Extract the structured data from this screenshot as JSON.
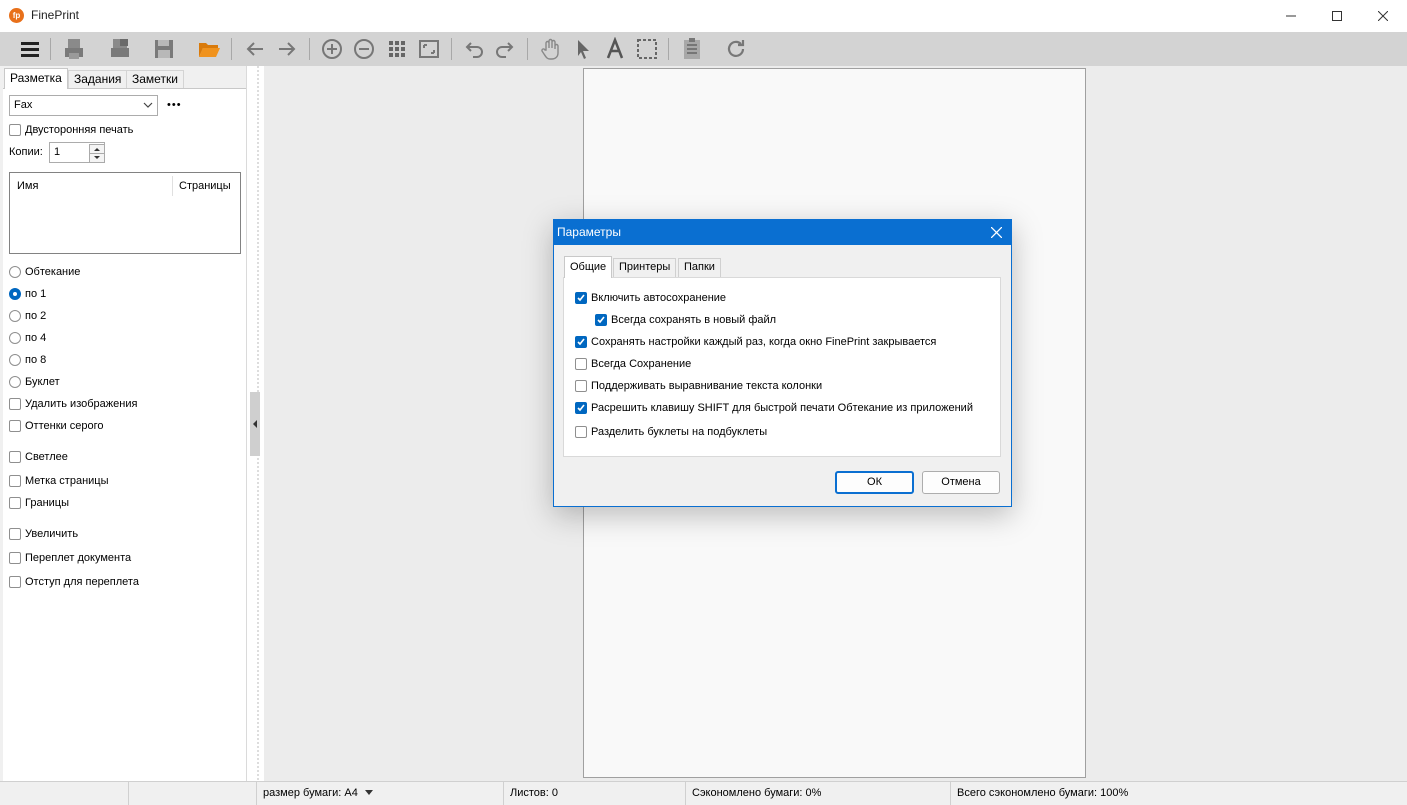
{
  "window": {
    "title": "FinePrint",
    "app_icon_text": "fp"
  },
  "toolbar": {
    "icons": [
      "menu-icon",
      "print-icon",
      "print-preview-icon",
      "save-icon",
      "open-folder-icon",
      "back-arrow-icon",
      "forward-arrow-icon",
      "zoom-in-icon",
      "zoom-out-icon",
      "grid-view-icon",
      "fit-page-icon",
      "undo-icon",
      "redo-icon",
      "hand-icon",
      "pointer-icon",
      "text-icon",
      "select-region-icon",
      "page-setup-icon",
      "refresh-icon"
    ]
  },
  "left_panel": {
    "tabs": [
      "Разметка",
      "Задания",
      "Заметки"
    ],
    "printer_combo": "Fax",
    "more_button": "•••",
    "duplex_label": "Двусторонняя печать",
    "copies_label": "Копии:",
    "copies_value": "1",
    "list_headers": {
      "name": "Имя",
      "pages": "Страницы"
    },
    "radios": [
      {
        "label": "Обтекание",
        "checked": false
      },
      {
        "label": "по 1",
        "checked": true
      },
      {
        "label": "по 2",
        "checked": false
      },
      {
        "label": "по 4",
        "checked": false
      },
      {
        "label": "по 8",
        "checked": false
      },
      {
        "label": "Буклет",
        "checked": false
      }
    ],
    "checks": [
      {
        "label": "Удалить изображения",
        "checked": false
      },
      {
        "label": "Оттенки серого",
        "checked": false
      },
      {
        "label": "Светлее",
        "checked": false
      },
      {
        "label": "Метка страницы",
        "checked": false
      },
      {
        "label": "Границы",
        "checked": false
      },
      {
        "label": "Увеличить",
        "checked": false
      },
      {
        "label": "Переплет документа",
        "checked": false
      },
      {
        "label": "Отступ для переплета",
        "checked": false
      }
    ]
  },
  "status_bar": {
    "paper_size": "размер бумаги: A4",
    "sheets": "Листов: 0",
    "paper_saved": "Сэкономлено бумаги: 0%",
    "total_saved": "Всего сэкономлено бумаги: 100%"
  },
  "dialog": {
    "title": "Параметры",
    "tabs": [
      "Общие",
      "Принтеры",
      "Папки"
    ],
    "options": [
      {
        "label": "Включить автосохранение",
        "checked": true
      },
      {
        "label": "Всегда сохранять в новый файл",
        "checked": true
      },
      {
        "label": "Сохранять настройки каждый раз, когда окно FinePrint закрывается",
        "checked": true
      },
      {
        "label": "Всегда Сохранение",
        "checked": false
      },
      {
        "label": "Поддерживать выравнивание текста колонки",
        "checked": false
      },
      {
        "label": "Расрешить клавишу SHIFT для быстрой печати Обтекание из приложений",
        "checked": true
      },
      {
        "label": "Разделить буклеты на подбуклеты",
        "checked": false
      }
    ],
    "ok_label": "ОК",
    "cancel_label": "Отмена"
  },
  "colors": {
    "accent": "#0a6fd1",
    "toolbar_bg": "#d3d3d3",
    "canvas_bg": "#ececec",
    "app_icon": "#e8701a"
  }
}
